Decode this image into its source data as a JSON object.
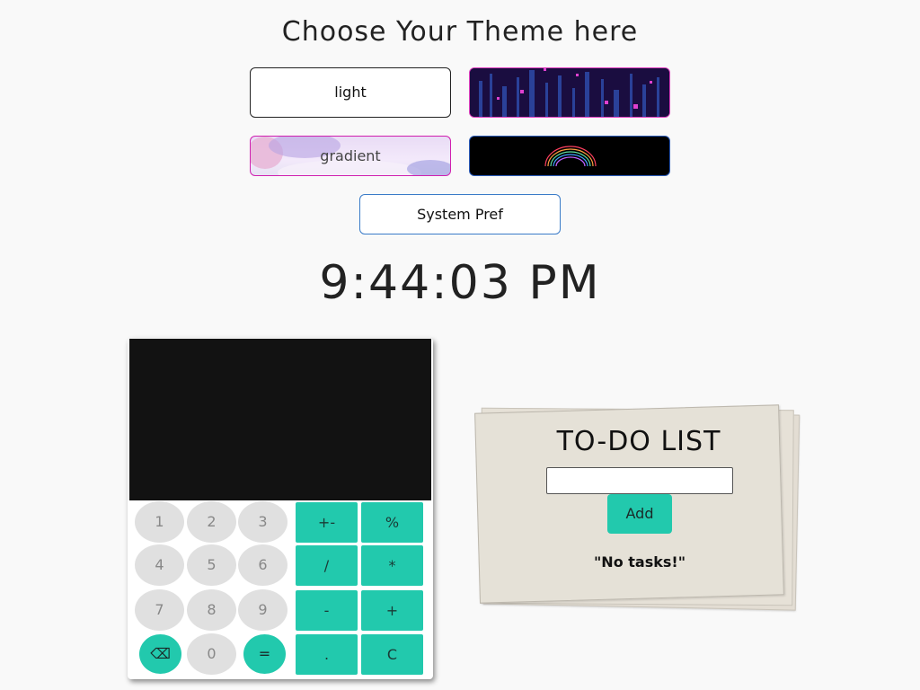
{
  "header": {
    "title": "Choose Your Theme here"
  },
  "themes": {
    "light": "light",
    "gradient": "gradient",
    "system": "System Pref"
  },
  "clock": {
    "time": "9:44:03 PM"
  },
  "calculator": {
    "keys": {
      "one": "1",
      "two": "2",
      "three": "3",
      "four": "4",
      "five": "5",
      "six": "6",
      "seven": "7",
      "eight": "8",
      "nine": "9",
      "zero": "0",
      "plus_minus": "+-",
      "percent": "%",
      "divide": "/",
      "multiply": "*",
      "minus": "-",
      "plus": "+",
      "dot": ".",
      "clear": "C",
      "backspace": "⌫",
      "equals": "="
    }
  },
  "todo": {
    "title": "TO-DO LIST",
    "add_label": "Add",
    "empty_text": "\"No tasks!\"",
    "input_value": ""
  },
  "colors": {
    "accent": "#22c9ad",
    "background": "#f9f9f9",
    "calc_screen": "#121212",
    "key_gray": "#e0e0e0",
    "paper": "#e5e1d7"
  }
}
